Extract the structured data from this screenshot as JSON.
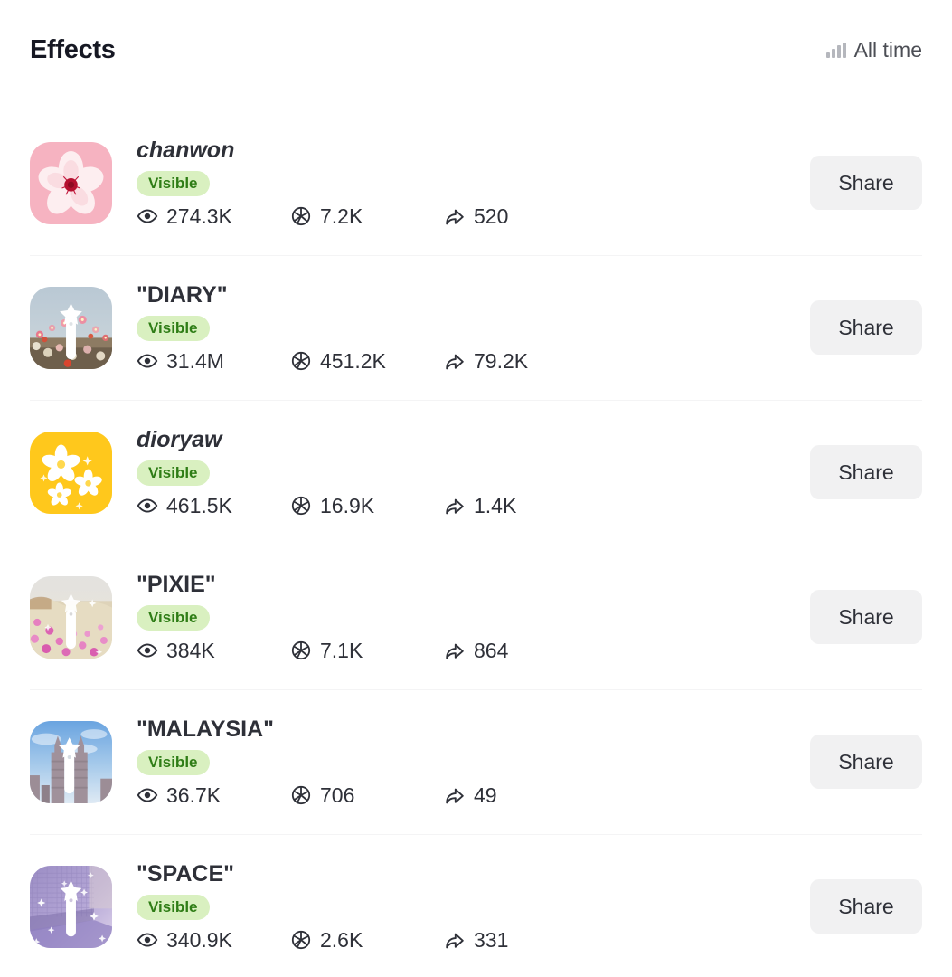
{
  "header": {
    "title": "Effects",
    "range_label": "All time",
    "range_icon": "bar-chart-icon"
  },
  "stat_icons": {
    "views": "eye-icon",
    "captures": "aperture-icon",
    "shares": "share-arrow-icon"
  },
  "colors": {
    "badge_bg": "#d9f0c0",
    "badge_text": "#2f7d16",
    "button_bg": "#f1f1f2",
    "divider": "#f4f4f5",
    "text": "#2e3038"
  },
  "rows": [
    {
      "name": "chanwon",
      "italic": true,
      "status": "Visible",
      "views": "274.3K",
      "captures": "7.2K",
      "shares": "520",
      "share_label": "Share",
      "thumb": "cherry-blossom-pink"
    },
    {
      "name": "\"DIARY\"",
      "italic": false,
      "status": "Visible",
      "views": "31.4M",
      "captures": "451.2K",
      "shares": "79.2K",
      "share_label": "Share",
      "thumb": "flower-field-wand"
    },
    {
      "name": "dioryaw",
      "italic": true,
      "status": "Visible",
      "views": "461.5K",
      "captures": "16.9K",
      "shares": "1.4K",
      "share_label": "Share",
      "thumb": "yellow-daisies"
    },
    {
      "name": "\"PIXIE\"",
      "italic": false,
      "status": "Visible",
      "views": "384K",
      "captures": "7.1K",
      "shares": "864",
      "share_label": "Share",
      "thumb": "pink-meadow-wand"
    },
    {
      "name": "\"MALAYSIA\"",
      "italic": false,
      "status": "Visible",
      "views": "36.7K",
      "captures": "706",
      "shares": "49",
      "share_label": "Share",
      "thumb": "petronas-towers-wand"
    },
    {
      "name": "\"SPACE\"",
      "italic": false,
      "status": "Visible",
      "views": "340.9K",
      "captures": "2.6K",
      "shares": "331",
      "share_label": "Share",
      "thumb": "purple-sparkle-wand"
    }
  ]
}
